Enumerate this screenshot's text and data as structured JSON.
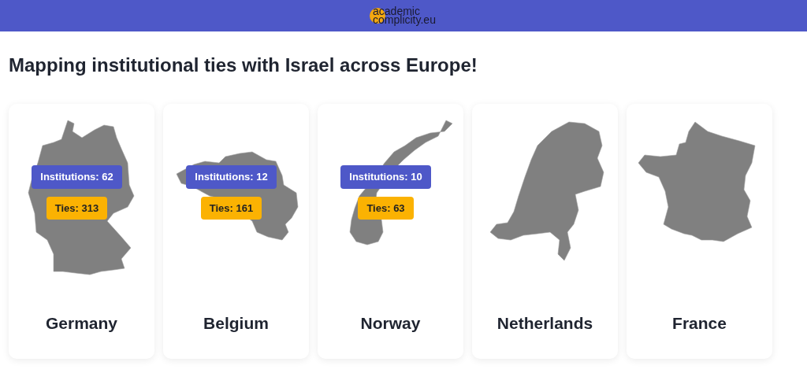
{
  "header": {
    "logo": {
      "line_1": "academic",
      "line_2": "complicity.eu"
    }
  },
  "title": "Mapping institutional ties with Israel across Europe!",
  "countries": [
    {
      "kind": "germany",
      "name": "Germany",
      "institutions": "Institutions: 62",
      "ties": "Ties: 313"
    },
    {
      "kind": "belgium",
      "name": "Belgium",
      "institutions": "Institutions: 12",
      "ties": "Ties: 161"
    },
    {
      "kind": "norway",
      "name": "Norway",
      "institutions": "Institutions: 10",
      "ties": "Ties: 63"
    },
    {
      "kind": "netherlands",
      "name": "Netherlands"
    },
    {
      "kind": "france",
      "name": "France"
    }
  ]
}
